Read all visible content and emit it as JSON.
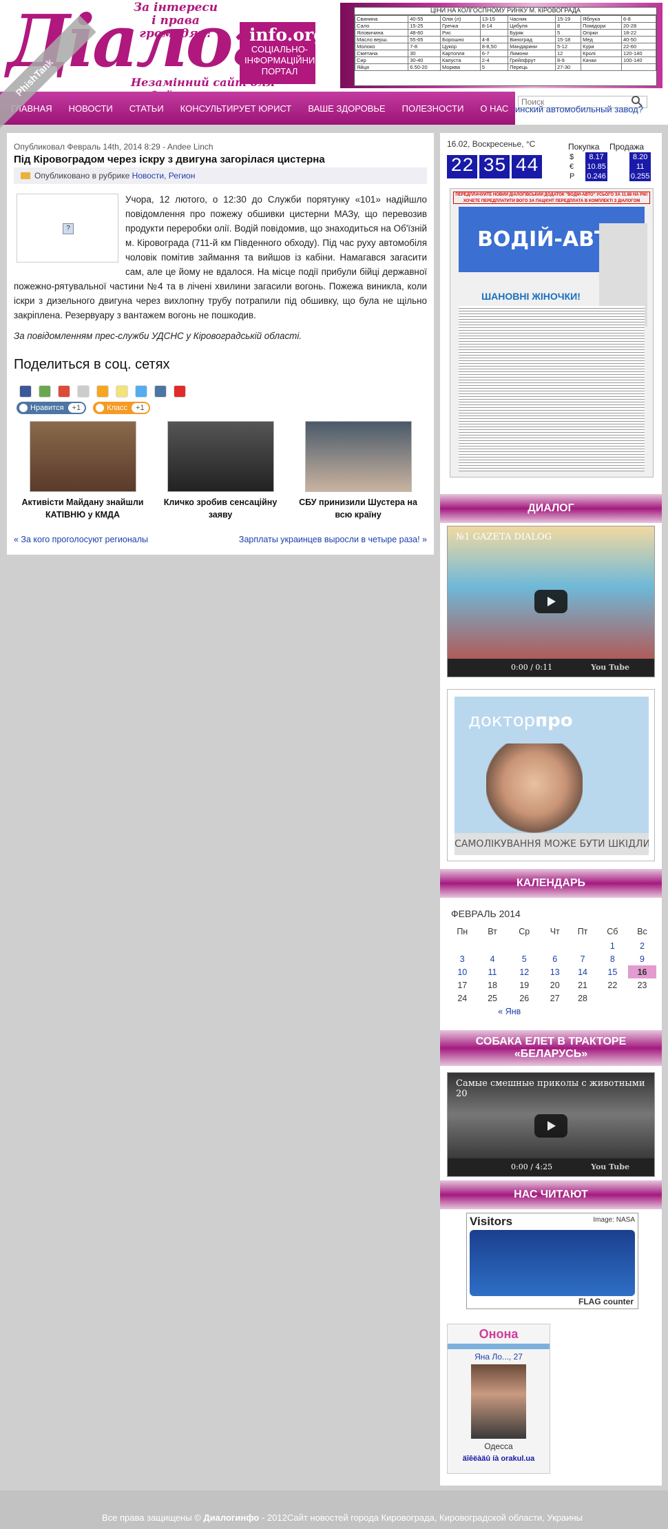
{
  "header": {
    "logo_text": "Діалог",
    "slogan": "За інтереси і права громадян!",
    "domain": "info.org",
    "subtitle": "СОЦІАЛЬНО-ІНФОРМАЦІЙНИЙ ПОРТАЛ",
    "tagline": "Незамінний сайт для людей",
    "watermark": "PhishTank"
  },
  "price_table": {
    "caption": "ЦІНИ НА КОЛГОСПНОМУ РИНКУ М. КІРОВОГРАДА",
    "rows": [
      [
        "Свинина",
        "40-55",
        "Олія (л)",
        "13-15",
        "Часник",
        "15-19",
        "Яблука",
        "6-8"
      ],
      [
        "Сало",
        "15-25",
        "Гречка",
        "8-14",
        "Цибуля",
        "8",
        "Помідори",
        "20-28"
      ],
      [
        "Яловичина",
        "48-60",
        "Рис",
        "",
        "Буряк",
        "5",
        "Огірки",
        "18-22"
      ],
      [
        "Масло верш.",
        "55-65",
        "Борошно",
        "4-8",
        "Виноград",
        "15-18",
        "Мед",
        "40-50"
      ],
      [
        "Молоко",
        "7-8",
        "Цукор",
        "8-8,50",
        "Мандарини",
        "5-12",
        "Кури",
        "22-60"
      ],
      [
        "Сметана",
        "30",
        "Картопля",
        "6-7",
        "Лимони",
        "12",
        "Кролі",
        "120-140"
      ],
      [
        "Сир",
        "30-40",
        "Капуста",
        "2-4",
        "Грейпфрут",
        "8-9",
        "Качки",
        "100-140"
      ],
      [
        "Яйця",
        "6.50-20",
        "Морква",
        "5",
        "Перець",
        "27-30",
        "",
        ""
      ]
    ]
  },
  "nav": {
    "items": [
      "Главная",
      "Новости",
      "Статьи",
      "Консультирует юрист",
      "Ваше здоровье",
      "Полезности",
      "О нас"
    ]
  },
  "search": {
    "placeholder": "Поиск",
    "ticker": "инский автомобильный завод?"
  },
  "article": {
    "meta": "Опубликовал Февраль 14th, 2014 8:29 - Andee Linch",
    "title": "Під Кіровоградом через іскру з двигуна загорілася цистерна",
    "category_prefix": "Опубликовано в рубрике",
    "category_1": "Новости",
    "category_sep": ",",
    "category_2": "Регион",
    "body": "Учора, 12 лютого, о 12:30 до Служби порятунку «101» надійшло повідомлення про пожежу обшивки цистерни МАЗу, що перевозив продукти переробки олії. Водій повідомив, що знаходиться на Об'їзній м. Кіровограда (711-й км Південного обходу). Під час руху автомобіля чоловік помітив займання та вийшов із кабіни. Намагався загасити сам, але це йому не вдалося. На місце події прибули бійці державної пожежно-рятувальної частини №4 та в лічені хвилини загасили вогонь. Пожежа виникла, коли іскри з дизельного двигуна через вихлопну трубу потрапили під обшивку, що була не щільно закріплена. Резервуару з вантажем вогонь не пошкодив.",
    "press": "За повідомленням прес-служби УДСНС у Кіровоградській області.",
    "image_placeholder": "?"
  },
  "share": {
    "title": "Поделиться в соц. сетях",
    "like_vk": "Нравится",
    "like_vk_count": "+1",
    "like_ok": "Класс",
    "like_ok_count": "+1"
  },
  "related": [
    {
      "caption": "Активісти Майдану знайшли КАТІВНЮ у КМДА"
    },
    {
      "caption": "Кличко зробив сенсаційну заяву"
    },
    {
      "caption": "СБУ принизили Шустера на всю країну"
    }
  ],
  "prevnext": {
    "prev": "« За кого проголосуют регионалы",
    "next": "Зарплаты украинцев выросли в четыре раза! »"
  },
  "currency": {
    "date": "16.02, Воскресенье, °C",
    "clock": [
      "22",
      "35",
      "44"
    ],
    "buy_label": "Покупка",
    "sell_label": "Продажа",
    "rows": [
      {
        "sym": "$",
        "buy": "8.17",
        "sell": "8.20"
      },
      {
        "sym": "€",
        "buy": "10.85",
        "sell": "11"
      },
      {
        "sym": "Р",
        "buy": "0.246",
        "sell": "0.255"
      }
    ]
  },
  "promo": {
    "top_text": "ПЕРЕДПЛАЧУЙТЕ НОВИЙ ДІАЛОГІВСЬКИЙ ДОДАТОК \"ВОДІЙ-АВТО\" УСЬОГО ЗА 11.88 НА РІК! ХОЧЕТЕ ПЕРЕДПЛАТИТИ ВОГО ЗА ПАЦІЄНТ ПЕРЕДПЛАТА В КОМПЛЕКТІ З ДІАЛОГОМ",
    "mast": "ВОДІЙ-АВТО",
    "wish": "ШАНОВНІ ЖІНОЧКИ!"
  },
  "widgets": {
    "dialog_title": "ДИАЛОГ",
    "video1_title": "№1 GAZETA DIALOG",
    "video1_time": "0:00",
    "video1_duration": "/ 0:11",
    "yt": "You Tube",
    "doctor_brand_a": "доктор",
    "doctor_brand_b": "про",
    "doctor_slogan": "САМОЛІКУВАННЯ МОЖЕ БУТИ ШКІДЛИВИМ ДЛЯ ВАШОГО ЗДОРОВ'Я",
    "calendar_title": "КАЛЕНДАРЬ",
    "dog_title": "СОБАКА ЕЛЕТ В ТРАКТОРЕ «БЕЛАРУСЬ»",
    "video2_title": "Самые смешные приколы с животными 20",
    "video2_time": "0:00",
    "video2_duration": "/ 4:25",
    "readers_title": "НАС ЧИТАЮТ",
    "map_visitors": "Visitors",
    "map_credit": "Image: NASA",
    "map_flag": "FLAG counter"
  },
  "calendar": {
    "month": "ФЕВРАЛЬ 2014",
    "days": [
      "Пн",
      "Вт",
      "Ср",
      "Чт",
      "Пт",
      "Сб",
      "Вс"
    ],
    "weeks": [
      [
        "",
        "",
        "",
        "",
        "",
        "1",
        "2"
      ],
      [
        "3",
        "4",
        "5",
        "6",
        "7",
        "8",
        "9"
      ],
      [
        "10",
        "11",
        "12",
        "13",
        "14",
        "15",
        "16"
      ],
      [
        "17",
        "18",
        "19",
        "20",
        "21",
        "22",
        "23"
      ],
      [
        "24",
        "25",
        "26",
        "27",
        "28",
        "",
        ""
      ]
    ],
    "linked": [
      "1",
      "2",
      "3",
      "4",
      "5",
      "6",
      "7",
      "8",
      "9",
      "10",
      "11",
      "12",
      "13",
      "14",
      "15"
    ],
    "today": "16",
    "prev_link": "« Янв"
  },
  "profile": {
    "logo": "Онона",
    "name": "Яна Ло..., 27",
    "city": "Одесса",
    "link": "äîêëàäû íà orakul.ua"
  },
  "footer": {
    "text_a": "Все права защищены",
    "symbol": "©",
    "brand": "Диалогинфо",
    "text_b": "- 2012Сайт новостей города Кировограда, Кировоградской области, Украины"
  },
  "colors": {
    "brand": "#b0187e",
    "nav": "#a41a7f",
    "clock": "#1a1aa8",
    "link": "#1a3fa8",
    "today": "#e39bd0"
  }
}
